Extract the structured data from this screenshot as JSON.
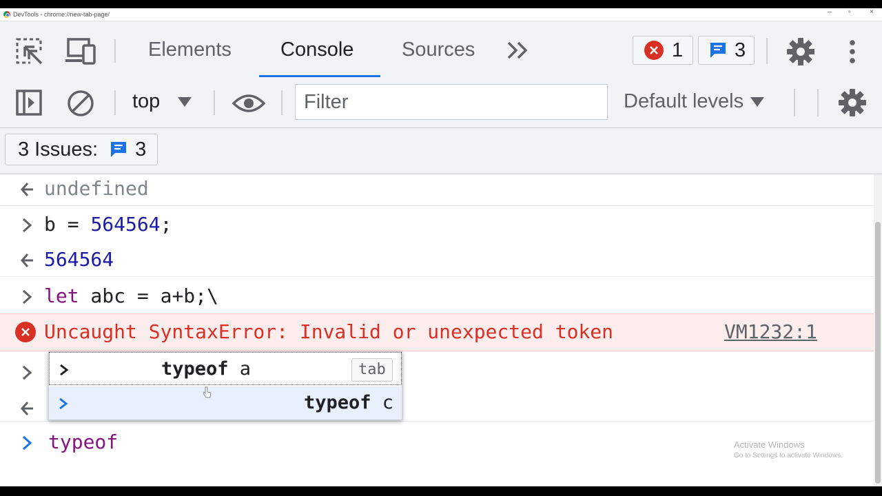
{
  "titlebar": {
    "title": "DevTools - chrome://new-tab-page/",
    "minimize": "–",
    "restore": "▫",
    "close": "×"
  },
  "tabs": {
    "elements": "Elements",
    "console": "Console",
    "sources": "Sources",
    "more": "»"
  },
  "counters": {
    "errors": "1",
    "messages": "3"
  },
  "toolbar": {
    "context": "top",
    "filter_placeholder": "Filter",
    "levels": "Default levels"
  },
  "issues": {
    "label": "3 Issues:",
    "count": "3"
  },
  "console": {
    "rows": [
      {
        "dir": "out",
        "text": "undefined"
      },
      {
        "dir": "in",
        "var": "b",
        "op": " = ",
        "num": "564564",
        "semi": ";"
      },
      {
        "dir": "out",
        "num": "564564"
      },
      {
        "dir": "in",
        "kw": "let",
        "rest": " abc = a+b;\\"
      },
      {
        "dir": "error",
        "text": "Uncaught SyntaxError: Invalid or unexpected token",
        "link": "VM1232:1"
      }
    ],
    "prompt_text": "typeof"
  },
  "autocomplete": {
    "items": [
      {
        "kw": "typeof",
        "arg": " a",
        "hint": "tab"
      },
      {
        "kw": "typeof",
        "arg": " c"
      }
    ]
  },
  "watermark": {
    "line1": "Activate Windows",
    "line2": "Go to Settings to activate Windows."
  },
  "colors": {
    "accent": "#1a73e8",
    "error": "#d93025",
    "number": "#1a1aa6",
    "keyword": "#881280",
    "error_bg": "#fdeded"
  }
}
